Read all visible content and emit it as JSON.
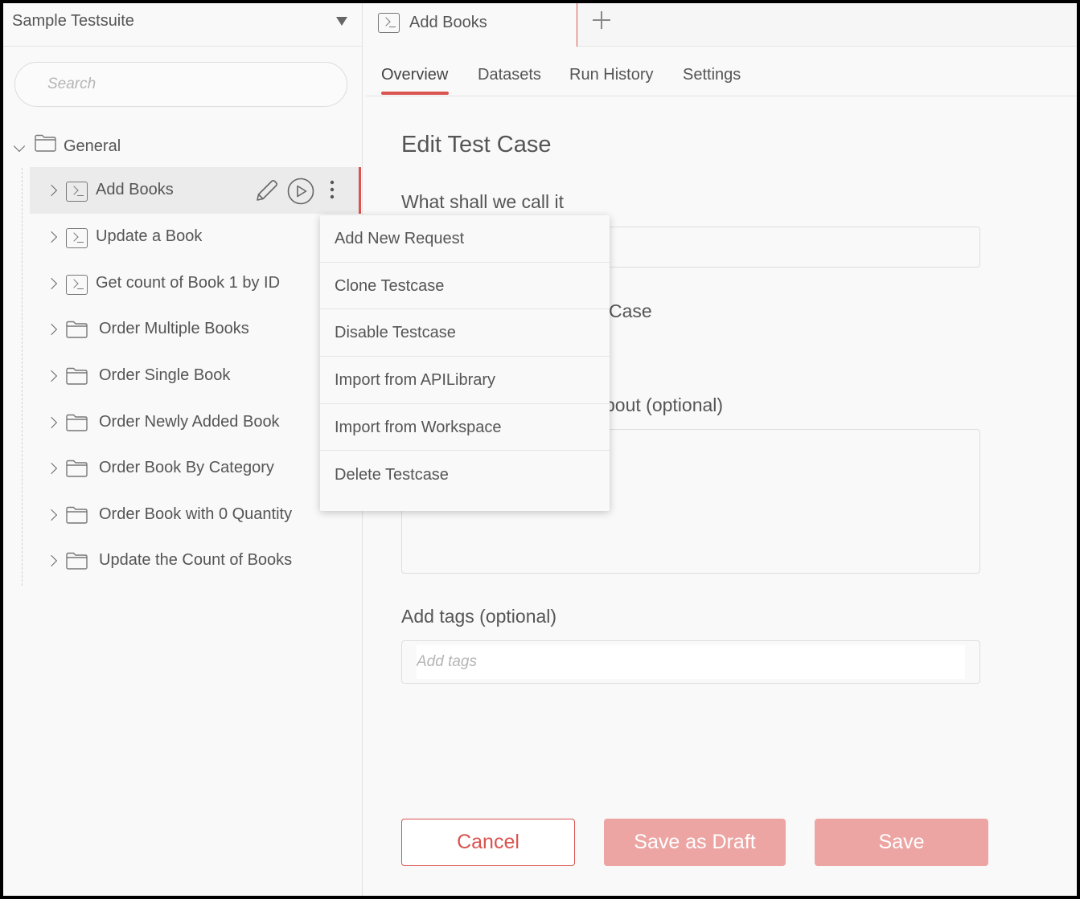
{
  "sidebar": {
    "suite_name": "Sample Testsuite",
    "search_placeholder": "Search",
    "root_folder": "General",
    "items": [
      {
        "label": "Add Books",
        "type": "testcase",
        "selected": true
      },
      {
        "label": "Update a Book",
        "type": "testcase"
      },
      {
        "label": "Get count of Book 1 by ID",
        "type": "testcase"
      },
      {
        "label": "Order Multiple Books",
        "type": "folder"
      },
      {
        "label": "Order Single Book",
        "type": "folder"
      },
      {
        "label": "Order Newly Added Book",
        "type": "folder"
      },
      {
        "label": "Order Book By Category",
        "type": "folder"
      },
      {
        "label": "Order Book with 0 Quantity",
        "type": "folder"
      },
      {
        "label": "Update the Count of Books",
        "type": "folder"
      }
    ],
    "row_actions": [
      "pencil-icon",
      "play-icon",
      "kebab-icon"
    ]
  },
  "context_menu": {
    "items": [
      "Add New Request",
      "Clone Testcase",
      "Disable Testcase",
      "Import from APILibrary",
      "Import from Workspace",
      "Delete Testcase"
    ]
  },
  "main": {
    "file_tab_title": "Add Books",
    "subtabs": [
      "Overview",
      "Datasets",
      "Run History",
      "Settings"
    ],
    "active_subtab": "Overview",
    "heading": "Edit Test Case",
    "name_label": "What shall we call it",
    "type_label_visible": "Case",
    "description_label_visible": "bout (optional)",
    "tags_label": "Add tags (optional)",
    "tags_placeholder": "Add tags",
    "buttons": {
      "cancel": "Cancel",
      "save_draft": "Save as Draft",
      "save": "Save"
    }
  },
  "colors": {
    "accent": "#d9534f",
    "disabled_button": "#eca5a3",
    "background": "#f9f9f9"
  }
}
